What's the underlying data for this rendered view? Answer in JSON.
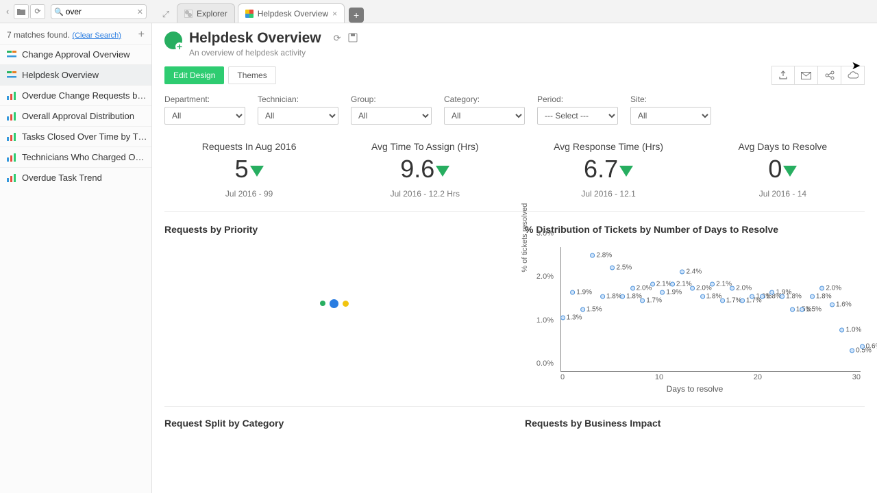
{
  "search": {
    "value": "over",
    "clear_icon": "✕"
  },
  "tabs": {
    "explorer": "Explorer",
    "current": "Helpdesk Overview"
  },
  "sidebar": {
    "matches_text": "7 matches found.",
    "clear_search": "(Clear Search)",
    "items": [
      {
        "label": "Change Approval Overview",
        "icon": "dash"
      },
      {
        "label": "Helpdesk Overview",
        "icon": "dash",
        "selected": true
      },
      {
        "label": "Overdue Change Requests b…",
        "icon": "bar"
      },
      {
        "label": "Overall Approval Distribution",
        "icon": "bar"
      },
      {
        "label": "Tasks Closed Over Time by T…",
        "icon": "bar"
      },
      {
        "label": "Technicians Who Charged O…",
        "icon": "bar"
      },
      {
        "label": "Overdue Task Trend",
        "icon": "bar"
      }
    ]
  },
  "page": {
    "title": "Helpdesk Overview",
    "subtitle": "An overview of helpdesk activity"
  },
  "toolbar": {
    "edit_design": "Edit Design",
    "themes": "Themes"
  },
  "filters": [
    {
      "label": "Department:",
      "value": "All"
    },
    {
      "label": "Technician:",
      "value": "All"
    },
    {
      "label": "Group:",
      "value": "All"
    },
    {
      "label": "Category:",
      "value": "All"
    },
    {
      "label": "Period:",
      "value": "--- Select ---"
    },
    {
      "label": "Site:",
      "value": "All"
    }
  ],
  "kpis": [
    {
      "title": "Requests In Aug 2016",
      "value": "5",
      "compare": "Jul 2016 - 99"
    },
    {
      "title": "Avg Time To Assign (Hrs)",
      "value": "9.6",
      "compare": "Jul 2016 - 12.2 Hrs"
    },
    {
      "title": "Avg Response Time (Hrs)",
      "value": "6.7",
      "compare": "Jul 2016 - 12.1"
    },
    {
      "title": "Avg Days to Resolve",
      "value": "0",
      "compare": "Jul 2016 - 14"
    }
  ],
  "chart_titles": {
    "priority": "Requests by Priority",
    "distribution": "% Distribution of Tickets by Number of Days to Resolve",
    "split_category": "Request Split by Category",
    "business_impact": "Requests by Business Impact"
  },
  "chart_data": {
    "type": "scatter",
    "title": "% Distribution of Tickets by Number of Days to Resolve",
    "xlabel": "Days to resolve",
    "ylabel": "% of tickets resolved",
    "xlim": [
      0,
      30
    ],
    "ylim": [
      0,
      3.0
    ],
    "yticks": [
      "0.0%",
      "1.0%",
      "2.0%",
      "3.0%"
    ],
    "xticks": [
      "0",
      "10",
      "20",
      "30"
    ],
    "points": [
      {
        "x": 1,
        "y": 1.3,
        "label": "1.3%"
      },
      {
        "x": 2,
        "y": 1.9,
        "label": "1.9%"
      },
      {
        "x": 3,
        "y": 1.5,
        "label": "1.5%"
      },
      {
        "x": 4,
        "y": 2.8,
        "label": "2.8%"
      },
      {
        "x": 5,
        "y": 1.8,
        "label": "1.8%"
      },
      {
        "x": 6,
        "y": 2.5,
        "label": "2.5%"
      },
      {
        "x": 7,
        "y": 1.8,
        "label": "1.8%"
      },
      {
        "x": 8,
        "y": 2.0,
        "label": "2.0%"
      },
      {
        "x": 9,
        "y": 1.7,
        "label": "1.7%"
      },
      {
        "x": 10,
        "y": 2.1,
        "label": "2.1%"
      },
      {
        "x": 11,
        "y": 1.9,
        "label": "1.9%"
      },
      {
        "x": 12,
        "y": 2.1,
        "label": "2.1%"
      },
      {
        "x": 13,
        "y": 2.4,
        "label": "2.4%"
      },
      {
        "x": 14,
        "y": 2.0,
        "label": "2.0%"
      },
      {
        "x": 15,
        "y": 1.8,
        "label": "1.8%"
      },
      {
        "x": 16,
        "y": 2.1,
        "label": "2.1%"
      },
      {
        "x": 17,
        "y": 1.7,
        "label": "1.7%"
      },
      {
        "x": 18,
        "y": 2.0,
        "label": "2.0%"
      },
      {
        "x": 19,
        "y": 1.7,
        "label": "1.7%"
      },
      {
        "x": 20,
        "y": 1.8,
        "label": "1.8%"
      },
      {
        "x": 21,
        "y": 1.8,
        "label": "1.8%"
      },
      {
        "x": 22,
        "y": 1.9,
        "label": "1.9%"
      },
      {
        "x": 23,
        "y": 1.8,
        "label": "1.8%"
      },
      {
        "x": 24,
        "y": 1.5,
        "label": "1.5%"
      },
      {
        "x": 25,
        "y": 1.5,
        "label": "1.5%"
      },
      {
        "x": 26,
        "y": 1.8,
        "label": "1.8%"
      },
      {
        "x": 27,
        "y": 2.0,
        "label": "2.0%"
      },
      {
        "x": 28,
        "y": 1.6,
        "label": "1.6%"
      },
      {
        "x": 29,
        "y": 1.0,
        "label": "1.0%"
      },
      {
        "x": 30,
        "y": 0.5,
        "label": "0.5%"
      },
      {
        "x": 31,
        "y": 0.6,
        "label": "0.6%"
      }
    ]
  }
}
